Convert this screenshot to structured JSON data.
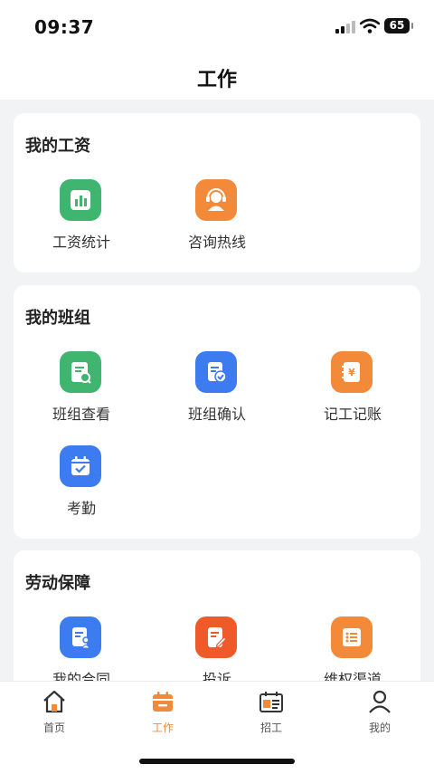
{
  "status": {
    "time": "09:37",
    "battery": "65"
  },
  "header": {
    "title": "工作"
  },
  "sections": [
    {
      "title": "我的工资",
      "items": [
        {
          "label": "工资统计",
          "icon": "chart-icon",
          "color": "#3fb56f"
        },
        {
          "label": "咨询热线",
          "icon": "customer-service-icon",
          "color": "#f28a3a"
        }
      ]
    },
    {
      "title": "我的班组",
      "items": [
        {
          "label": "班组查看",
          "icon": "document-search-icon",
          "color": "#3fb56f"
        },
        {
          "label": "班组确认",
          "icon": "document-check-icon",
          "color": "#3d7bf0"
        },
        {
          "label": "记工记账",
          "icon": "yuan-notebook-icon",
          "color": "#f28a3a"
        },
        {
          "label": "考勤",
          "icon": "calendar-check-icon",
          "color": "#3d7bf0"
        }
      ]
    },
    {
      "title": "劳动保障",
      "items": [
        {
          "label": "我的合同",
          "icon": "contract-icon",
          "color": "#3d7bf0"
        },
        {
          "label": "投诉",
          "icon": "complaint-edit-icon",
          "color": "#ef5a2a"
        },
        {
          "label": "维权渠道",
          "icon": "list-icon",
          "color": "#f28a3a"
        }
      ]
    }
  ],
  "tabs": [
    {
      "label": "首页",
      "icon": "home-icon"
    },
    {
      "label": "工作",
      "icon": "work-calendar-icon",
      "active": true
    },
    {
      "label": "招工",
      "icon": "recruit-icon"
    },
    {
      "label": "我的",
      "icon": "person-icon"
    }
  ],
  "accent_color": "#f28a3a"
}
